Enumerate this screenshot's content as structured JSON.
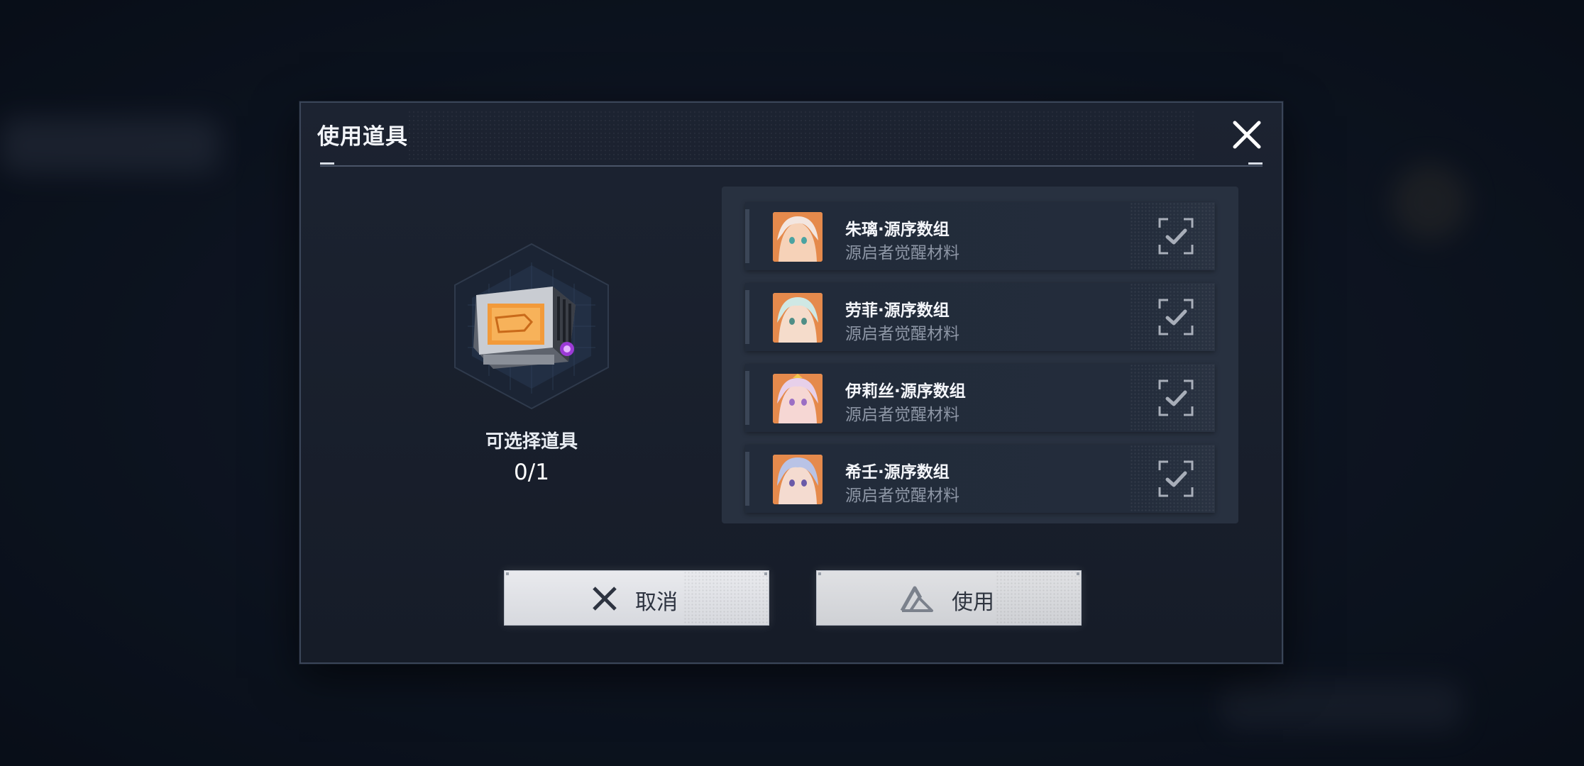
{
  "dialog": {
    "title": "使用道具",
    "close_icon": "close-icon"
  },
  "item": {
    "label": "可选择道具",
    "count": "0/1",
    "icon": "supply-crate-icon"
  },
  "options": [
    {
      "name": "朱璃·源序数组",
      "subtitle": "源启者觉醒材料",
      "portrait": "character-portrait",
      "selected": false
    },
    {
      "name": "劳菲·源序数组",
      "subtitle": "源启者觉醒材料",
      "portrait": "character-portrait",
      "selected": false
    },
    {
      "name": "伊莉丝·源序数组",
      "subtitle": "源启者觉醒材料",
      "portrait": "character-portrait",
      "selected": false
    },
    {
      "name": "希壬·源序数组",
      "subtitle": "源启者觉醒材料",
      "portrait": "character-portrait",
      "selected": false
    }
  ],
  "buttons": {
    "cancel_label": "取消",
    "use_label": "使用"
  },
  "colors": {
    "accent_orange": "#f29a3a",
    "dialog_bg": "#1a2130",
    "button_bg": "#e2e4e8"
  }
}
